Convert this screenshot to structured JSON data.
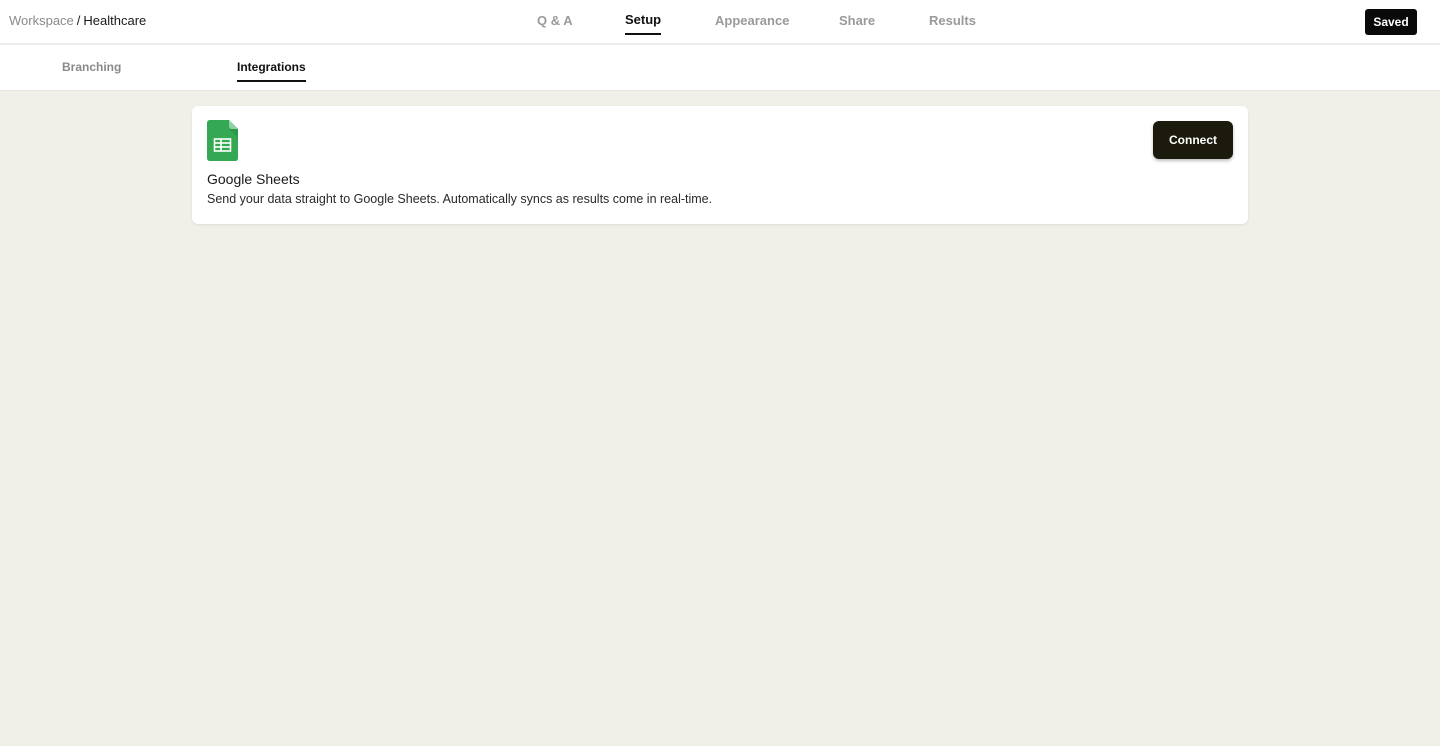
{
  "breadcrumb": {
    "root": "Workspace",
    "separator": "/",
    "current": "Healthcare"
  },
  "main_tabs": [
    {
      "label": "Q & A",
      "active": false
    },
    {
      "label": "Setup",
      "active": true
    },
    {
      "label": "Appearance",
      "active": false
    },
    {
      "label": "Share",
      "active": false
    },
    {
      "label": "Results",
      "active": false
    }
  ],
  "saved_label": "Saved",
  "sub_tabs": [
    {
      "label": "Branching",
      "active": false
    },
    {
      "label": "Integrations",
      "active": true
    }
  ],
  "integration": {
    "icon": "google-sheets-icon",
    "title": "Google Sheets",
    "description": "Send your data straight to Google Sheets. Automatically syncs as results come in real-time.",
    "connect_label": "Connect"
  },
  "colors": {
    "page_background": "#f0f0e8",
    "sheets_green": "#34a853",
    "button_dark": "#1c1a0c"
  }
}
